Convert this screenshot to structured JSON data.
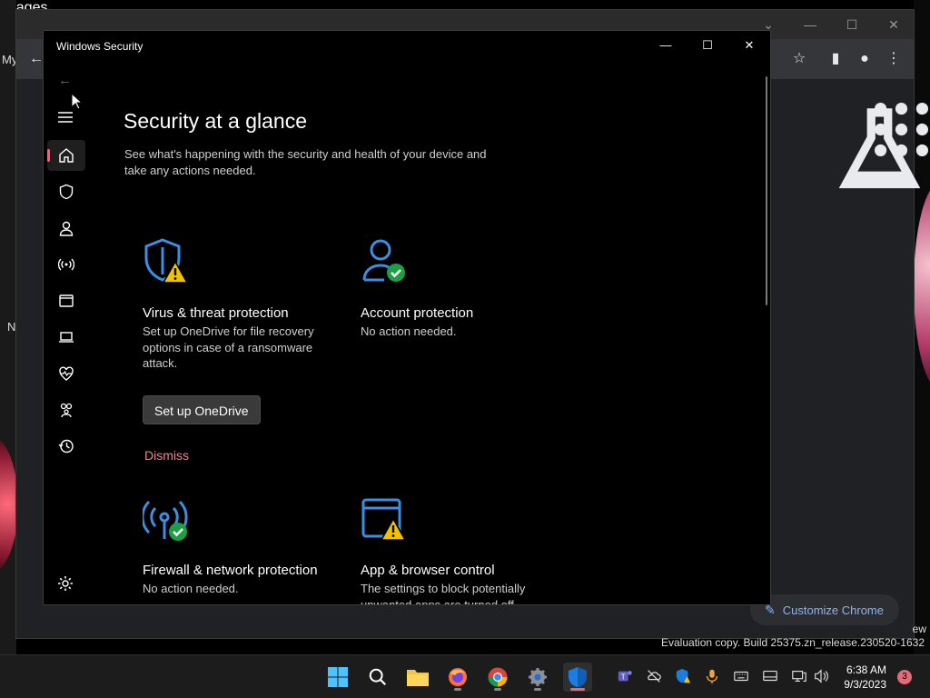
{
  "desktop": {
    "left_texts": [
      "My",
      "N"
    ],
    "eval_line": "Evaluation copy. Build 25375.zn_release.230520-1632",
    "ew_text": "ew"
  },
  "chrome": {
    "images_link": "Images",
    "customize_label": "Customize Chrome"
  },
  "security": {
    "window_title": "Windows Security",
    "heading": "Security at a glance",
    "subheading": "See what's happening with the security and health of your device and take any actions needed.",
    "accent": "#e36a77",
    "cards": [
      {
        "icon": "shield-warning-icon",
        "title": "Virus & threat protection",
        "desc": "Set up OneDrive for file recovery options in case of a ransomware attack.",
        "button": "Set up OneDrive",
        "link": "Dismiss"
      },
      {
        "icon": "account-check-icon",
        "title": "Account protection",
        "desc": "No action needed."
      },
      {
        "icon": "network-check-icon",
        "title": "Firewall & network protection",
        "desc": "No action needed."
      },
      {
        "icon": "app-browser-warning-icon",
        "title": "App & browser control",
        "desc": "The settings to block potentially unwanted apps are turned off."
      }
    ],
    "nav": [
      "home-icon",
      "shield-icon",
      "person-icon",
      "wireless-icon",
      "app-window-icon",
      "laptop-icon",
      "health-icon",
      "family-icon",
      "history-icon"
    ]
  },
  "taskbar": {
    "time": "6:38 AM",
    "date": "9/3/2023",
    "notification_count": "3"
  }
}
